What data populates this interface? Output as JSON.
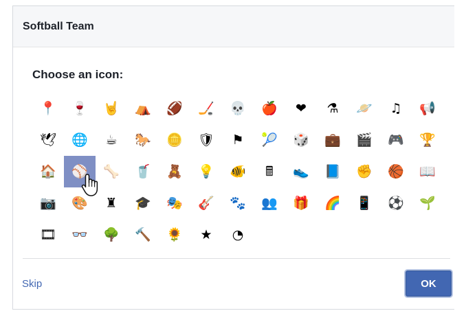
{
  "dialog": {
    "title": "Softball Team",
    "prompt": "Choose an icon:",
    "skip_label": "Skip",
    "ok_label": "OK",
    "selected_icon": "baseball-icon"
  },
  "icons": [
    {
      "name": "pin-icon",
      "glyph": "📍"
    },
    {
      "name": "wine-glass-icon",
      "glyph": "🍷"
    },
    {
      "name": "rock-hand-icon",
      "glyph": "🤘"
    },
    {
      "name": "camping-tent-icon",
      "glyph": "⛺"
    },
    {
      "name": "football-icon",
      "glyph": "🏈"
    },
    {
      "name": "hockey-puck-icon",
      "glyph": "🏒"
    },
    {
      "name": "skull-icon",
      "glyph": "💀"
    },
    {
      "name": "apple-icon",
      "glyph": "🍎"
    },
    {
      "name": "heart-rate-icon",
      "glyph": "❤"
    },
    {
      "name": "flask-icon",
      "glyph": "⚗"
    },
    {
      "name": "planet-icon",
      "glyph": "🪐"
    },
    {
      "name": "music-note-icon",
      "glyph": "♫"
    },
    {
      "name": "megaphone-icon",
      "glyph": "📢"
    },
    {
      "name": "dove-icon",
      "glyph": "🕊"
    },
    {
      "name": "globe-icon",
      "glyph": "🌐"
    },
    {
      "name": "coffee-mug-icon",
      "glyph": "☕"
    },
    {
      "name": "horse-icon",
      "glyph": "🐎"
    },
    {
      "name": "coin-icon",
      "glyph": "🪙"
    },
    {
      "name": "shield-icon",
      "glyph": "🛡"
    },
    {
      "name": "flag-icon",
      "glyph": "⚑"
    },
    {
      "name": "tennis-ball-icon",
      "glyph": "🎾"
    },
    {
      "name": "dice-icon",
      "glyph": "🎲"
    },
    {
      "name": "briefcase-icon",
      "glyph": "💼"
    },
    {
      "name": "clapperboard-icon",
      "glyph": "🎬"
    },
    {
      "name": "game-controller-icon",
      "glyph": "🎮"
    },
    {
      "name": "trophy-icon",
      "glyph": "🏆"
    },
    {
      "name": "house-icon",
      "glyph": "🏠"
    },
    {
      "name": "baseball-icon",
      "glyph": "⚾"
    },
    {
      "name": "bone-icon",
      "glyph": "🦴"
    },
    {
      "name": "cup-icon",
      "glyph": "🥤"
    },
    {
      "name": "teddy-bear-icon",
      "glyph": "🧸"
    },
    {
      "name": "light-bulb-icon",
      "glyph": "💡"
    },
    {
      "name": "fish-bowl-icon",
      "glyph": "🐠"
    },
    {
      "name": "calculator-icon",
      "glyph": "🖩"
    },
    {
      "name": "sneaker-icon",
      "glyph": "👟"
    },
    {
      "name": "notebook-icon",
      "glyph": "📘"
    },
    {
      "name": "fist-icon",
      "glyph": "✊"
    },
    {
      "name": "basketball-icon",
      "glyph": "🏀"
    },
    {
      "name": "book-icon",
      "glyph": "📖"
    },
    {
      "name": "camera-icon",
      "glyph": "📷"
    },
    {
      "name": "paint-palette-icon",
      "glyph": "🎨"
    },
    {
      "name": "chess-rook-icon",
      "glyph": "♜"
    },
    {
      "name": "graduation-cap-icon",
      "glyph": "🎓"
    },
    {
      "name": "theater-masks-icon",
      "glyph": "🎭"
    },
    {
      "name": "guitar-icon",
      "glyph": "🎸"
    },
    {
      "name": "paw-print-icon",
      "glyph": "🐾"
    },
    {
      "name": "contacts-icon",
      "glyph": "👥"
    },
    {
      "name": "gift-icon",
      "glyph": "🎁"
    },
    {
      "name": "rainbow-icon",
      "glyph": "🌈"
    },
    {
      "name": "tablet-icon",
      "glyph": "📱"
    },
    {
      "name": "soccer-ball-icon",
      "glyph": "⚽"
    },
    {
      "name": "potted-plant-icon",
      "glyph": "🌱"
    },
    {
      "name": "film-strip-icon",
      "glyph": "🎞"
    },
    {
      "name": "eyeglasses-icon",
      "glyph": "👓"
    },
    {
      "name": "tree-icon",
      "glyph": "🌳"
    },
    {
      "name": "gavel-icon",
      "glyph": "🔨"
    },
    {
      "name": "sunflower-icon",
      "glyph": "🌻"
    },
    {
      "name": "star-badge-icon",
      "glyph": "★"
    },
    {
      "name": "pie-chart-icon",
      "glyph": "◔"
    }
  ]
}
